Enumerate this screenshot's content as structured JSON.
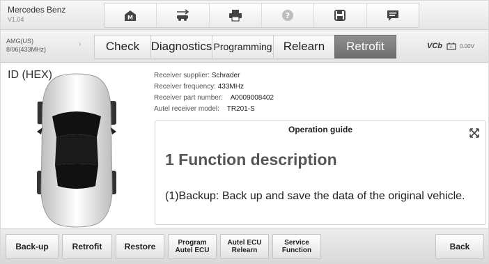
{
  "header": {
    "device_name": "Mercedes Benz",
    "device_version": "V1.04",
    "toolbar": [
      {
        "icon": "home-icon"
      },
      {
        "icon": "vehicle-swap-icon"
      },
      {
        "icon": "print-icon"
      },
      {
        "icon": "help-icon"
      },
      {
        "icon": "save-icon"
      },
      {
        "icon": "message-icon"
      }
    ]
  },
  "vehicle": {
    "model": "AMG(US)",
    "frequency": "8/06(433MHz)"
  },
  "tabs": [
    {
      "label": "Check"
    },
    {
      "label": "Diagnostics"
    },
    {
      "label": "Programming"
    },
    {
      "label": "Relearn"
    },
    {
      "label": "Retrofit"
    }
  ],
  "active_tab": "Retrofit",
  "vci": {
    "label": "VCb",
    "voltage": "0.00V"
  },
  "content": {
    "id_label": "ID (HEX)",
    "receiver": {
      "supplier_label": "Receiver supplier:",
      "supplier_value": "Schrader",
      "frequency_label": "Receiver frequency:",
      "frequency_value": "433MHz",
      "part_label": "Receiver part number:",
      "part_value": "A0009008402",
      "model_label": "Autel receiver model:",
      "model_value": "TR201-S"
    },
    "guide": {
      "title": "Operation guide",
      "heading": "1 Function description",
      "body": "(1)Backup: Back up and save the data of the original vehicle."
    }
  },
  "bottom_buttons": [
    {
      "line1": "Back-up",
      "line2": ""
    },
    {
      "line1": "Retrofit",
      "line2": ""
    },
    {
      "line1": "Restore",
      "line2": ""
    },
    {
      "line1": "Program",
      "line2": "Autel ECU"
    },
    {
      "line1": "Autel ECU",
      "line2": "Relearn"
    },
    {
      "line1": "Service",
      "line2": "Function"
    },
    {
      "line1": "Back",
      "line2": ""
    }
  ],
  "colors": {
    "active_tab": "#7a7a7a",
    "background": "#f0f0f0"
  }
}
